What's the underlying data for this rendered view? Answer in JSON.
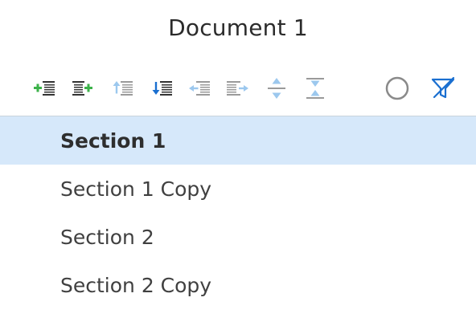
{
  "document": {
    "title": "Document 1"
  },
  "toolbar": {
    "buttons": [
      {
        "name": "add-section-before",
        "icon": "add-before-icon"
      },
      {
        "name": "add-section-after",
        "icon": "add-after-icon"
      },
      {
        "name": "move-up",
        "icon": "move-up-icon"
      },
      {
        "name": "move-down",
        "icon": "move-down-icon"
      },
      {
        "name": "outdent",
        "icon": "outdent-icon"
      },
      {
        "name": "indent",
        "icon": "indent-icon"
      },
      {
        "name": "expand-all",
        "icon": "expand-icon"
      },
      {
        "name": "collapse-all",
        "icon": "collapse-icon"
      },
      {
        "name": "circle",
        "icon": "circle-icon"
      },
      {
        "name": "clear-filter",
        "icon": "filter-clear-icon"
      }
    ]
  },
  "sections": {
    "items": [
      {
        "label": "Section 1",
        "selected": true
      },
      {
        "label": "Section 1 Copy",
        "selected": false
      },
      {
        "label": "Section 2",
        "selected": false
      },
      {
        "label": "Section 2 Copy",
        "selected": false
      }
    ]
  },
  "colors": {
    "selected_bg": "#d6e8fa",
    "green": "#3cb24a",
    "blue": "#1a6fd0",
    "light_blue": "#9cc8ee",
    "gray_icon": "#8a8a8a"
  }
}
